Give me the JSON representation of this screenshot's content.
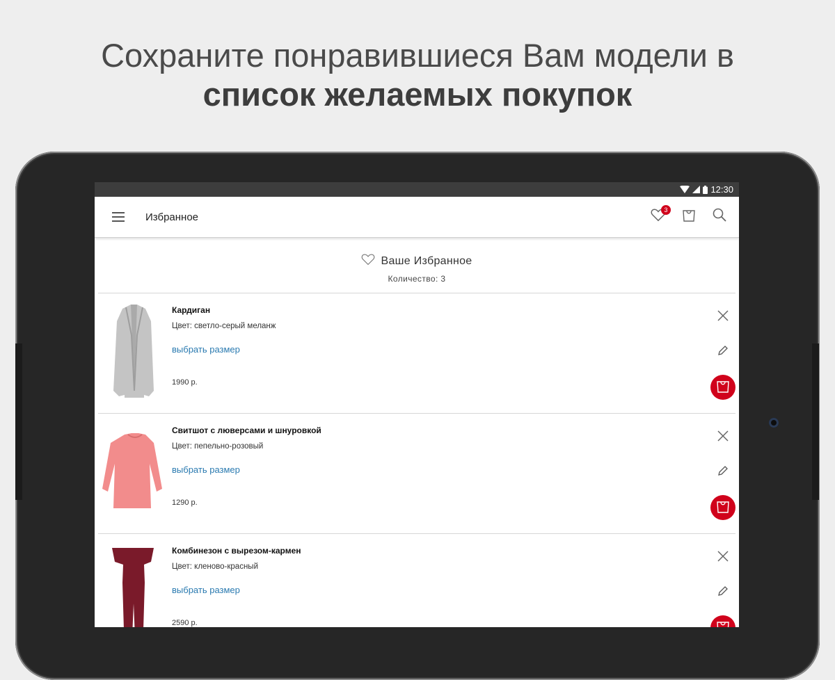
{
  "promo": {
    "line1": "Сохраните понравившиеся Вам модели в",
    "line2": "список желаемых покупок"
  },
  "status_bar": {
    "time": "12:30",
    "icons": [
      "wifi-icon",
      "signal-icon",
      "battery-icon"
    ]
  },
  "app_bar": {
    "menu_icon": "hamburger-menu-icon",
    "title": "Избранное",
    "wishlist_icon": "heart-icon",
    "wishlist_badge": "3",
    "cart_icon": "shopping-bag-icon",
    "search_icon": "search-icon"
  },
  "favorites": {
    "header_icon": "heart-outline-icon",
    "title": "Ваше Избранное",
    "count_label": "Количество: 3"
  },
  "items": [
    {
      "name": "Кардиган",
      "color": "Цвет: светло-серый меланж",
      "size_link": "выбрать размер",
      "price": "1990 р.",
      "thumb_color": "#c4c4c4"
    },
    {
      "name": "Свитшот с люверсами и шнуровкой",
      "color": "Цвет: пепельно-розовый",
      "size_link": "выбрать размер",
      "price": "1290 р.",
      "thumb_color": "#f28c8c"
    },
    {
      "name": "Комбинезон с вырезом-кармен",
      "color": "Цвет: кленово-красный",
      "size_link": "выбрать размер",
      "price": "2590 р.",
      "thumb_color": "#7a1a2a"
    }
  ],
  "colors": {
    "accent": "#d0021b",
    "link": "#2a7ab0",
    "status_bar": "#3d3d3d",
    "page_bg": "#eeeeee",
    "bezel": "#262626"
  }
}
